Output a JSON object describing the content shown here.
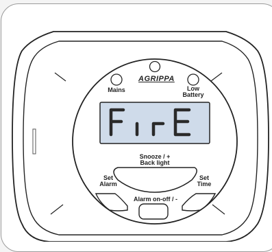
{
  "device": {
    "brand": "AGRIPPA",
    "display_text": "FirE",
    "indicators": [
      {
        "label": "Mains"
      },
      {
        "label": "Low\nBattery"
      }
    ],
    "buttons": {
      "snooze_backlight": "Snooze / +\nBack light",
      "set_alarm": "Set\nAlarm",
      "set_time": "Set\nTime",
      "alarm_on_off": "Alarm on-off / -"
    }
  },
  "colors": {
    "lcd_background": "#cfdbea",
    "lcd_segments": "#2a2a2a",
    "outline": "#222222"
  }
}
